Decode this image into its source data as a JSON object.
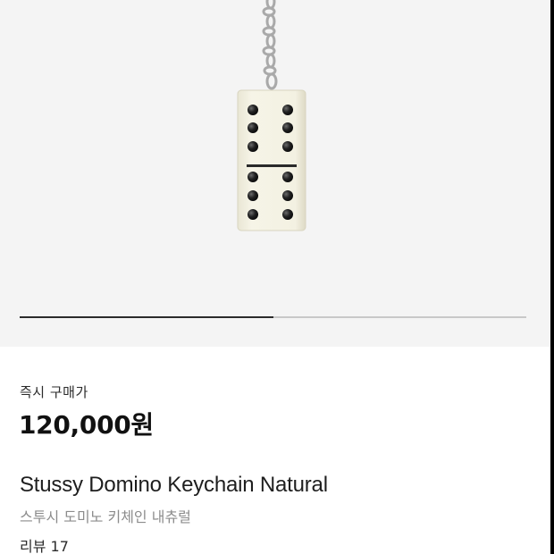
{
  "product_image": {
    "alt": "",
    "slide_progress": 0.5,
    "colors": {
      "background": "#f4f4f4",
      "domino": "#f4f2e3",
      "pips": "#1c1c1c",
      "chain": "#b7b7b7"
    }
  },
  "purchase": {
    "label": "즉시 구매가",
    "price": "120,000원"
  },
  "product": {
    "name": "Stussy Domino Keychain Natural",
    "name_ko": "스투시 도미노 키체인 내츄럴",
    "review": "리뷰 17"
  }
}
